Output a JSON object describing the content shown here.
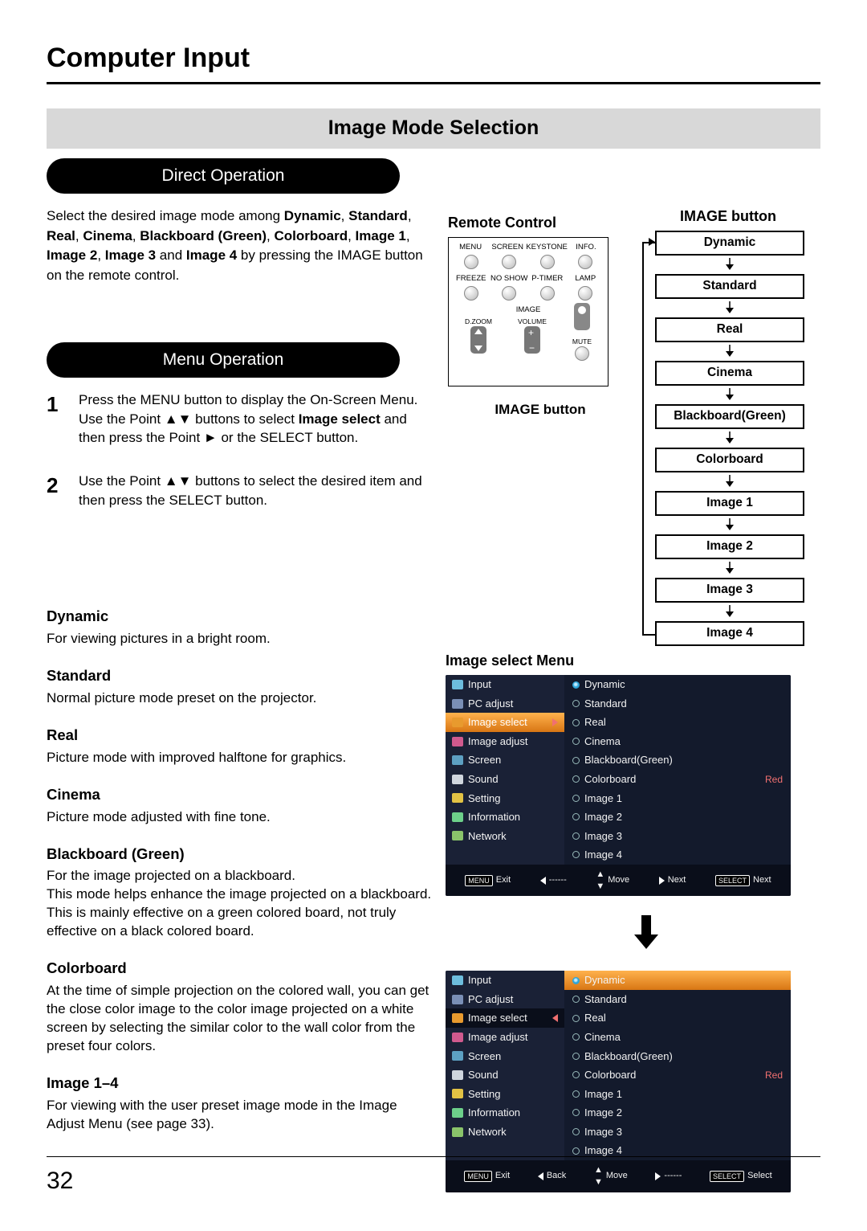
{
  "page_title": "Computer Input",
  "section_title": "Image Mode Selection",
  "direct_op_label": "Direct Operation",
  "menu_op_label": "Menu Operation",
  "intro_prefix": "Select the desired image mode among ",
  "intro_modes": [
    "Dynamic",
    "Standard",
    "Real",
    "Cinema",
    "Blackboard (Green)",
    "Colorboard",
    "Image 1",
    "Image 2",
    "Image 3",
    "Image 4"
  ],
  "intro_and": " and ",
  "intro_suffix": " by pressing the IMAGE button on the remote control.",
  "steps": [
    {
      "num": "1",
      "before": "Press the MENU button to display the On-Screen Menu. Use the Point ▲▼ buttons to select ",
      "bold": "Image select",
      "after": " and then press the Point ► or the SELECT button."
    },
    {
      "num": "2",
      "before": "Use the Point ▲▼ buttons to select  the desired item and then press the SELECT button.",
      "bold": "",
      "after": ""
    }
  ],
  "descriptions": [
    {
      "head": "Dynamic",
      "body": "For viewing pictures in a bright room."
    },
    {
      "head": "Standard",
      "body": "Normal picture mode preset on the projector."
    },
    {
      "head": "Real",
      "body": "Picture mode with improved halftone for graphics."
    },
    {
      "head": "Cinema",
      "body": "Picture mode adjusted with fine tone."
    },
    {
      "head": "Blackboard (Green)",
      "body": "For the image projected on a blackboard.\nThis mode helps enhance the image projected on a blackboard. This is mainly effective on a green colored board, not truly effective on a black colored board."
    },
    {
      "head": "Colorboard",
      "body": "At the time of simple projection on the colored wall, you can get the close color image to the color image projected on a white screen by selecting the similar color to the wall color from the preset four colors."
    },
    {
      "head": "Image 1–4",
      "body": "For viewing with the user preset image mode in the Image Adjust Menu (see page 33)."
    }
  ],
  "remote": {
    "title": "Remote Control",
    "caption": "IMAGE button",
    "top_row": [
      "MENU",
      "SCREEN",
      "KEYSTONE",
      "INFO."
    ],
    "mid_row": [
      "FREEZE",
      "NO SHOW",
      "P-TIMER",
      "LAMP"
    ],
    "image_label": "IMAGE",
    "dzoom": "D.ZOOM",
    "volume": "VOLUME",
    "mute": "MUTE"
  },
  "flow": {
    "title": "IMAGE button",
    "items": [
      "Dynamic",
      "Standard",
      "Real",
      "Cinema",
      "Blackboard(Green)",
      "Colorboard",
      "Image 1",
      "Image 2",
      "Image 3",
      "Image 4"
    ]
  },
  "osd": {
    "title": "Image select Menu",
    "left_items": [
      "Input",
      "PC adjust",
      "Image select",
      "Image adjust",
      "Screen",
      "Sound",
      "Setting",
      "Information",
      "Network"
    ],
    "right_items": [
      "Dynamic",
      "Standard",
      "Real",
      "Cinema",
      "Blackboard(Green)",
      "Colorboard",
      "Image 1",
      "Image 2",
      "Image 3",
      "Image 4"
    ],
    "red_tag": "Red",
    "foot1": {
      "exit": "Exit",
      "exit_key": "MENU",
      "back": "------",
      "move": "Move",
      "next1": "Next",
      "next2": "Next",
      "next_key": "SELECT"
    },
    "foot2": {
      "exit": "Exit",
      "exit_key": "MENU",
      "back": "Back",
      "move": "Move",
      "next1": "------",
      "next2": "Select",
      "next_key": "SELECT"
    }
  },
  "page_number": "32"
}
